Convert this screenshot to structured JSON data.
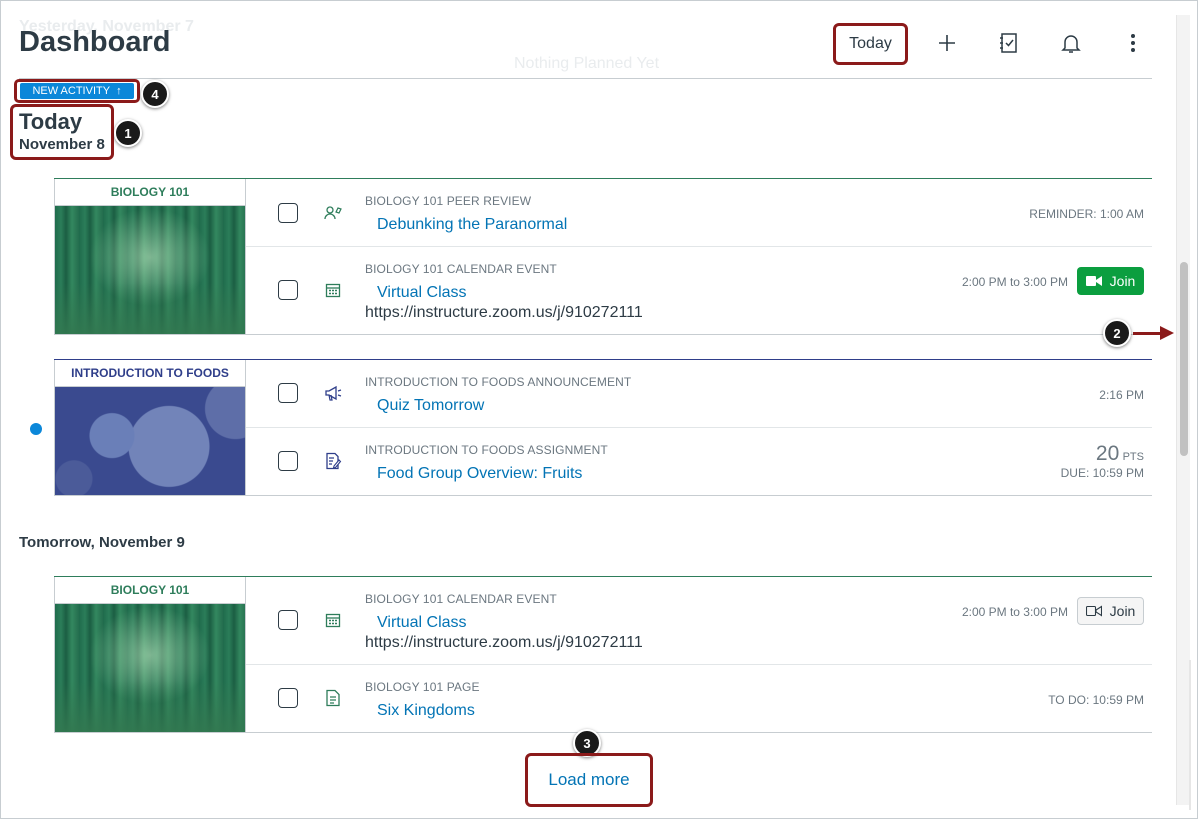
{
  "ghost": {
    "date": "Yesterday, November 7",
    "empty": "Nothing Planned Yet"
  },
  "header": {
    "title": "Dashboard",
    "today_button": "Today",
    "icons": [
      "plus-icon",
      "todo-list-icon",
      "bell-icon",
      "more-vertical-icon"
    ]
  },
  "new_activity": {
    "label": "NEW ACTIVITY",
    "arrow": "↑"
  },
  "callouts": {
    "c1": "1",
    "c2": "2",
    "c3": "3",
    "c4": "4"
  },
  "today": {
    "label": "Today",
    "date": "November 8"
  },
  "tomorrow": {
    "heading": "Tomorrow, November 9"
  },
  "groups": [
    {
      "course": "BIOLOGY 101",
      "color": "#2e7d5b",
      "items": [
        {
          "type": "BIOLOGY 101 PEER REVIEW",
          "title": "Debunking the Paranormal",
          "right": "REMINDER: 1:00 AM",
          "icon": "peer-review-icon"
        },
        {
          "type": "BIOLOGY 101 CALENDAR EVENT",
          "title": "Virtual Class",
          "url": "https://instructure.zoom.us/j/910272111",
          "right": "2:00 PM to 3:00 PM",
          "join": "Join",
          "icon": "calendar-icon"
        }
      ]
    },
    {
      "course": "INTRODUCTION TO FOODS",
      "color": "#2f3e8a",
      "items": [
        {
          "type": "INTRODUCTION TO FOODS ANNOUNCEMENT",
          "title": "Quiz Tomorrow",
          "right": "2:16 PM",
          "icon": "announcement-icon"
        },
        {
          "type": "INTRODUCTION TO FOODS ASSIGNMENT",
          "title": "Food Group Overview: Fruits",
          "pts": "20",
          "pts_unit": "PTS",
          "due": "DUE: 10:59 PM",
          "icon": "assignment-icon"
        }
      ]
    },
    {
      "course": "BIOLOGY 101",
      "color": "#2e7d5b",
      "items": [
        {
          "type": "BIOLOGY 101 CALENDAR EVENT",
          "title": "Virtual Class",
          "url": "https://instructure.zoom.us/j/910272111",
          "right": "2:00 PM to 3:00 PM",
          "join": "Join",
          "icon": "calendar-icon"
        },
        {
          "type": "BIOLOGY 101 PAGE",
          "title": "Six Kingdoms",
          "right": "TO DO: 10:59 PM",
          "icon": "page-icon"
        }
      ]
    }
  ],
  "load_more": "Load more",
  "colors": {
    "link": "#0374b5",
    "join_green": "#0b9e3f",
    "new_activity": "#0b87d9",
    "callout_border": "#8b1a1a"
  }
}
